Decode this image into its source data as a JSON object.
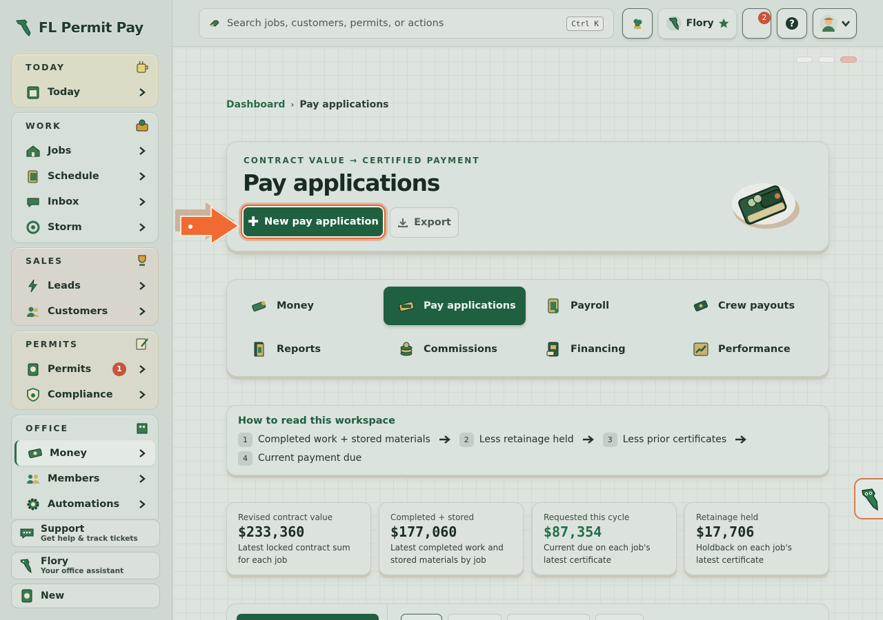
{
  "app": {
    "brand": "FL Permit Pay"
  },
  "sidebar": {
    "groups": [
      {
        "label": "TODAY",
        "items": [
          {
            "label": "Today"
          }
        ]
      },
      {
        "label": "WORK",
        "items": [
          {
            "label": "Jobs"
          },
          {
            "label": "Schedule"
          },
          {
            "label": "Inbox"
          },
          {
            "label": "Storm"
          }
        ]
      },
      {
        "label": "SALES",
        "items": [
          {
            "label": "Leads"
          },
          {
            "label": "Customers"
          }
        ]
      },
      {
        "label": "PERMITS",
        "items": [
          {
            "label": "Permits",
            "badge": "1"
          },
          {
            "label": "Compliance"
          }
        ]
      },
      {
        "label": "OFFICE",
        "items": [
          {
            "label": "Money",
            "active": true
          },
          {
            "label": "Members"
          },
          {
            "label": "Automations"
          }
        ]
      }
    ],
    "support": {
      "title": "Support",
      "subtitle": "Get help & track tickets"
    },
    "assistant": {
      "title": "Flory",
      "subtitle": "Your office assistant"
    },
    "new_label": "New"
  },
  "topbar": {
    "search_placeholder": "Search jobs, customers, permits, or actions",
    "shortcut": "Ctrl K",
    "assistant_name": "Flory",
    "notification_count": "2"
  },
  "breadcrumb": {
    "root": "Dashboard",
    "separator": "›",
    "current": "Pay applications"
  },
  "hero": {
    "eyebrow": "CONTRACT VALUE → CERTIFIED PAYMENT",
    "title": "Pay applications",
    "primary_label": "New pay application",
    "secondary_label": "Export"
  },
  "subnav": {
    "items": [
      {
        "label": "Money",
        "icon": "money-icon"
      },
      {
        "label": "Pay applications",
        "icon": "pay-applications-icon",
        "active": true
      },
      {
        "label": "Payroll",
        "icon": "payroll-icon"
      },
      {
        "label": "Crew payouts",
        "icon": "crew-payouts-icon"
      },
      {
        "label": "Reports",
        "icon": "reports-icon"
      },
      {
        "label": "Commissions",
        "icon": "commissions-icon"
      },
      {
        "label": "Financing",
        "icon": "financing-icon"
      },
      {
        "label": "Performance",
        "icon": "performance-icon"
      }
    ]
  },
  "howto": {
    "title": "How to read this workspace",
    "steps": [
      {
        "num": "1",
        "label": "Completed work + stored materials"
      },
      {
        "num": "2",
        "label": "Less retainage held"
      },
      {
        "num": "3",
        "label": "Less prior certificates"
      },
      {
        "num": "4",
        "label": "Current payment due"
      }
    ]
  },
  "stats": [
    {
      "label": "Revised contract value",
      "value": "$233,360",
      "desc": "Latest locked contract sum for each job"
    },
    {
      "label": "Completed + stored",
      "value": "$177,060",
      "desc": "Latest completed work and stored materials by job"
    },
    {
      "label": "Requested this cycle",
      "value": "$87,354",
      "desc": "Current due on each job's latest certificate",
      "highlight": true
    },
    {
      "label": "Retainage held",
      "value": "$17,706",
      "desc": "Holdback on each job's latest certificate"
    }
  ],
  "colors": {
    "primary": "#1f6040",
    "accent": "#e06836",
    "badge": "#c9543a"
  }
}
